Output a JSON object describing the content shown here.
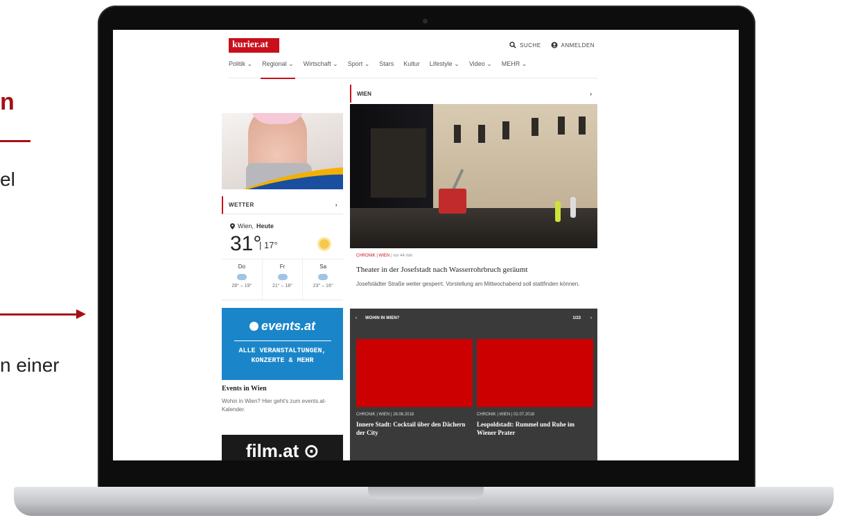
{
  "slide": {
    "title_fragment": "n",
    "text_fragment_1": "el",
    "text_fragment_2": "n einer"
  },
  "site": {
    "logo": "kurier.at",
    "search_label": "SUCHE",
    "login_label": "ANMELDEN",
    "nav": [
      "Politik ⌄",
      "Regional ⌄",
      "Wirtschaft ⌄",
      "Sport ⌄",
      "Stars",
      "Kultur",
      "Lifestyle ⌄",
      "Video ⌄",
      "MEHR ⌄"
    ]
  },
  "weather": {
    "header": "WETTER",
    "location": "Wien,",
    "location_bold": "Heute",
    "temp": "31°",
    "low": "| 17°",
    "days": [
      {
        "day": "Do",
        "range": "28° – 19°"
      },
      {
        "day": "Fr",
        "range": "21° – 18°"
      },
      {
        "day": "Sa",
        "range": "23° – 16°"
      }
    ]
  },
  "events": {
    "logo": "events.at",
    "tagline1": "ALLE VERANSTALTUNGEN,",
    "tagline2": "KONZERTE & MEHR",
    "title": "Events in Wien",
    "desc": "Wohin in Wien? Hier geht's zum events.at-Kalender."
  },
  "film": {
    "logo": "film.at ⊙"
  },
  "wien": {
    "header": "WIEN",
    "chronik": "CHRONIK | WIEN",
    "time": "| vor 44 min",
    "title": "Theater in der Josefstadt nach Wasserrohrbruch geräumt",
    "desc": "Josefstädter Straße weiter gesperrt. Vorstellung am Mittwochabend soll stattfinden können."
  },
  "wohin": {
    "header": "WOHIN IN WIEN?",
    "counter": "1/23",
    "cards": [
      {
        "meta": "CHRONIK | WIEN | 28.06.2018",
        "title": "Innere Stadt: Cocktail über den Dächern der City"
      },
      {
        "meta": "CHRONIK | WIEN | 02.07.2018",
        "title": "Leopoldstadt: Rummel und Ruhe im Wiener Prater"
      }
    ]
  },
  "colors": {
    "accent": "#c8101c",
    "events_blue": "#1a86c9",
    "slide_red": "#a50f15"
  }
}
